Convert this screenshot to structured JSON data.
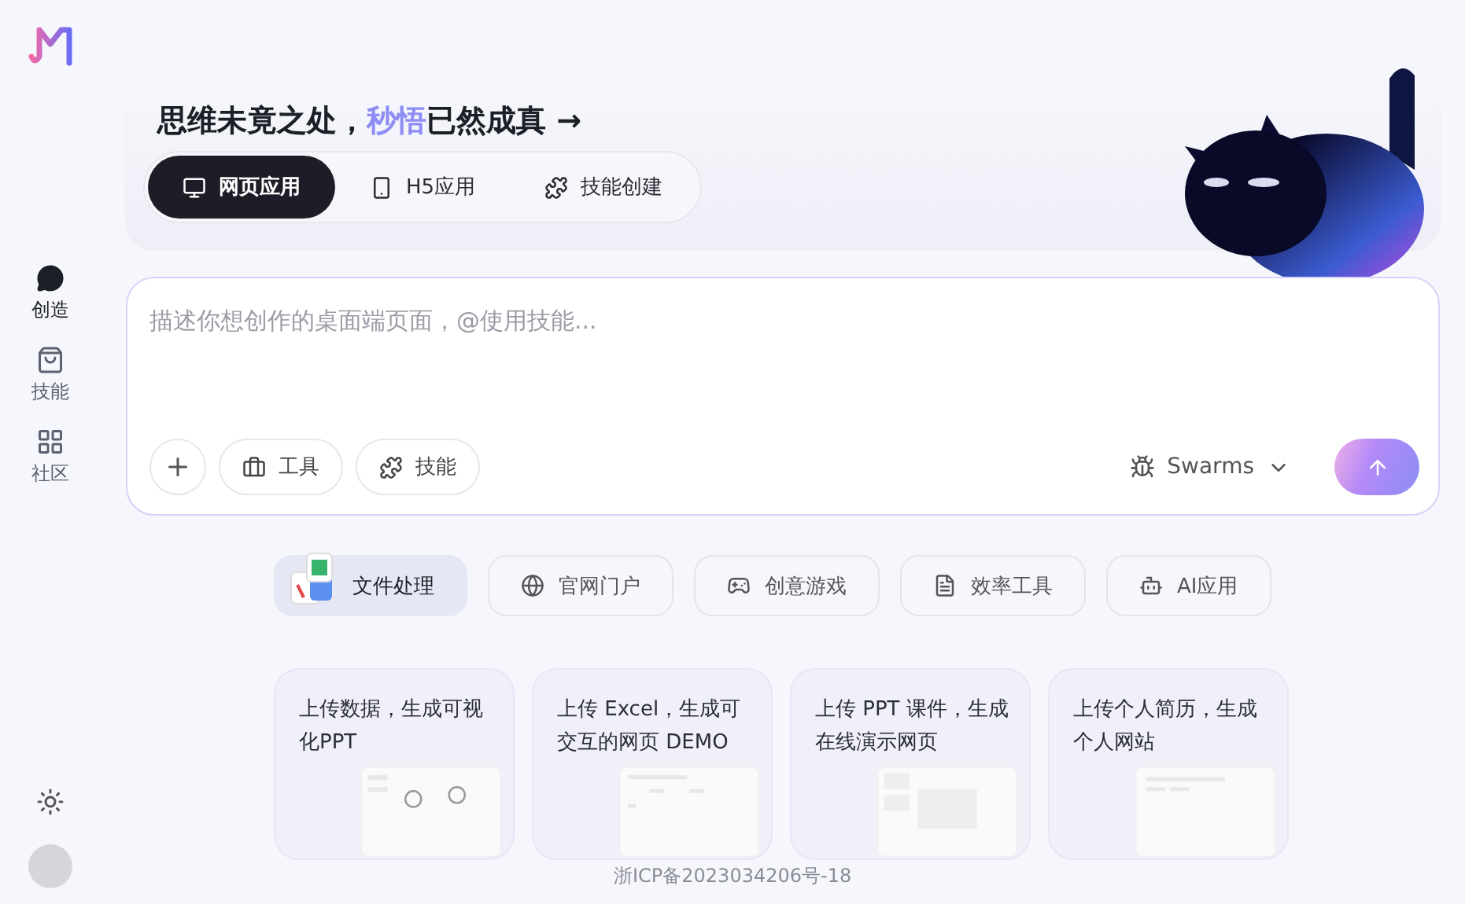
{
  "sidebar": {
    "items": [
      {
        "label": "创造",
        "kind": "create",
        "selected": true
      },
      {
        "label": "技能",
        "kind": "skills",
        "selected": false
      },
      {
        "label": "社区",
        "kind": "community",
        "selected": false
      }
    ]
  },
  "hero": {
    "title_before": "思维未竟之处，",
    "title_highlight": "秒悟",
    "title_after": "已然成真 →",
    "tabs": [
      {
        "label": "网页应用",
        "kind": "web",
        "selected": true
      },
      {
        "label": "H5应用",
        "kind": "mobile",
        "selected": false
      },
      {
        "label": "技能创建",
        "kind": "puzzle",
        "selected": false
      }
    ]
  },
  "composer": {
    "placeholder": "描述你想创作的桌面端页面，@使用技能...",
    "tools": [
      {
        "label": "工具",
        "kind": "toolbox"
      },
      {
        "label": "技能",
        "kind": "puzzle"
      }
    ],
    "model": "Swarms"
  },
  "categories": [
    {
      "label": "文件处理",
      "kind": "files",
      "selected": true
    },
    {
      "label": "官网门户",
      "kind": "globe",
      "selected": false
    },
    {
      "label": "创意游戏",
      "kind": "gamepad",
      "selected": false
    },
    {
      "label": "效率工具",
      "kind": "doc",
      "selected": false
    },
    {
      "label": "AI应用",
      "kind": "robot",
      "selected": false
    }
  ],
  "cards": [
    {
      "text": "上传数据，生成可视化PPT",
      "kind": "dashboard"
    },
    {
      "text": "上传 Excel，生成可交互的网页 DEMO",
      "kind": "table"
    },
    {
      "text": "上传 PPT 课件，生成在线演示网页",
      "kind": "slides"
    },
    {
      "text": "上传个人简历，生成个人网站",
      "kind": "profile"
    }
  ],
  "footer": "浙ICP备2023034206号-18"
}
